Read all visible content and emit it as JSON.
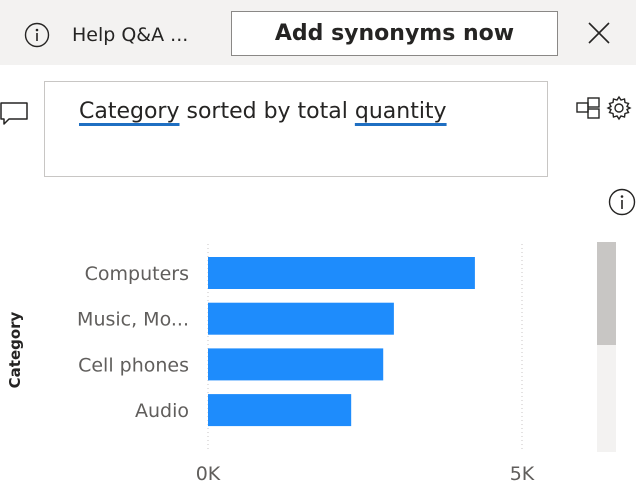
{
  "header": {
    "help_label": "Help Q&A ...",
    "add_synonyms_label": "Add synonyms now"
  },
  "question": {
    "term1": "Category",
    "mid": " sorted by total ",
    "term2": "quantity"
  },
  "icons": [
    "info-icon",
    "close-icon",
    "comment-icon",
    "convert-to-visual-icon",
    "gear-icon",
    "chart-info-icon"
  ],
  "colors": {
    "bar": "#1e8cfc",
    "accent_underline": "#1f6fc2",
    "topbar": "#f3f2f1"
  },
  "chart_data": {
    "type": "bar",
    "orientation": "horizontal",
    "ylabel": "Category",
    "categories": [
      "Computers",
      "Music, Mo...",
      "Cell phones",
      "Audio"
    ],
    "values": [
      4250,
      2960,
      2790,
      2280
    ],
    "xlim": [
      0,
      5000
    ],
    "x_ticks": [
      "0K",
      "5K"
    ],
    "grid": "vertical dotted"
  }
}
